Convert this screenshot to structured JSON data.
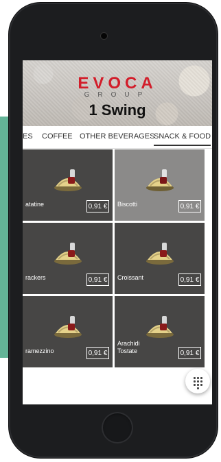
{
  "header": {
    "logo_main": "EVOCA",
    "logo_sub": "GROUP",
    "machine_name": "1 Swing"
  },
  "tabs": [
    {
      "label": "ES"
    },
    {
      "label": "COFFEE"
    },
    {
      "label": "OTHER BEVERAGES"
    },
    {
      "label": "SNACK & FOOD"
    }
  ],
  "products": [
    {
      "name": "atatine",
      "price": "0,91 €"
    },
    {
      "name": "Biscotti",
      "price": "0,91 €"
    },
    {
      "name": "rackers",
      "price": "0,91 €"
    },
    {
      "name": "Croissant",
      "price": "0,91 €"
    },
    {
      "name": "ramezzino",
      "price": "0,91 €"
    },
    {
      "name": "Arachidi\nTostate",
      "price": "0,91 €"
    }
  ],
  "icons": {
    "keypad": "keypad-icon",
    "product": "snack-tray-icon"
  },
  "colors": {
    "brand_red": "#d21d2a",
    "tile_dark": "#474645",
    "tile_selected": "#8b8a89",
    "side_green": "#64b497"
  }
}
